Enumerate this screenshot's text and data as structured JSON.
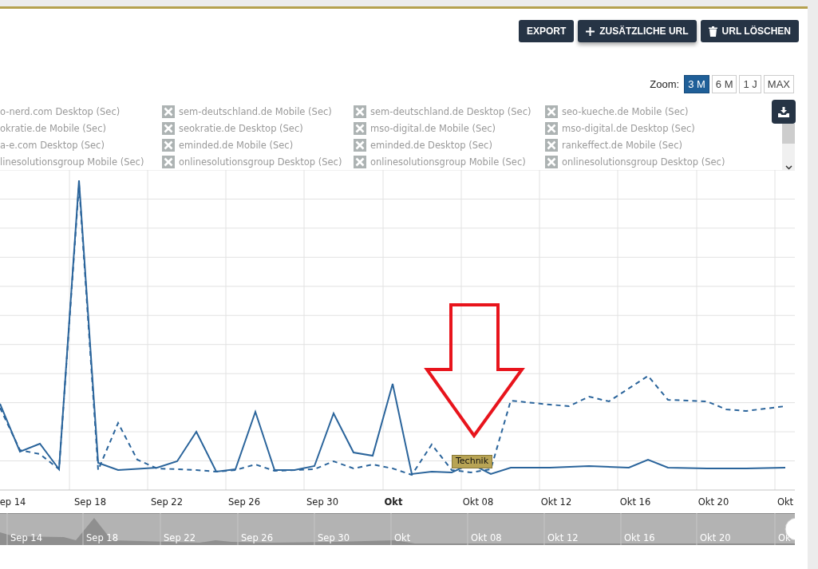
{
  "toolbar": {
    "buttons": [
      {
        "label": "EXPORT",
        "kind": "plain"
      },
      {
        "label": "ZUSÄTZLICHE URL",
        "kind": "add"
      },
      {
        "label": "URL LÖSCHEN",
        "kind": "delete"
      }
    ]
  },
  "zoom": {
    "label": "Zoom:",
    "options": [
      {
        "label": "3 M",
        "selected": true
      },
      {
        "label": "6 M",
        "selected": false
      },
      {
        "label": "1 J",
        "selected": false
      },
      {
        "label": "MAX",
        "selected": false
      }
    ]
  },
  "legend": {
    "items": [
      {
        "label": "o-nerd.com Desktop (Sec)",
        "kind": "partial"
      },
      {
        "label": "sem-deutschland.de Mobile (Sec)",
        "kind": "full"
      },
      {
        "label": "sem-deutschland.de Desktop (Sec)",
        "kind": "full"
      },
      {
        "label": "seo-kueche.de Mobile (Sec)",
        "kind": "full"
      },
      {
        "label": "okratie.de Mobile (Sec)",
        "kind": "partial"
      },
      {
        "label": "seokratie.de Desktop (Sec)",
        "kind": "full"
      },
      {
        "label": "mso-digital.de Mobile (Sec)",
        "kind": "full"
      },
      {
        "label": "mso-digital.de Desktop (Sec)",
        "kind": "full"
      },
      {
        "label": "a-e.com Desktop (Sec)",
        "kind": "partial"
      },
      {
        "label": "eminded.de Mobile (Sec)",
        "kind": "full"
      },
      {
        "label": "eminded.de Desktop (Sec)",
        "kind": "full"
      },
      {
        "label": "rankeffect.de Mobile (Sec)",
        "kind": "full"
      },
      {
        "label": "linesolutionsgroup Mobile (Sec)",
        "kind": "partial"
      },
      {
        "label": "onlinesolutionsgroup Desktop (Sec)",
        "kind": "full"
      },
      {
        "label": "onlinesolutionsgroup Mobile (Sec)",
        "kind": "full"
      },
      {
        "label": "onlinesolutionsgroup Desktop (Sec)",
        "kind": "full"
      }
    ]
  },
  "chart": {
    "x_labels": [
      {
        "label": "ep 14",
        "bold": false
      },
      {
        "label": "Sep 18",
        "bold": false
      },
      {
        "label": "Sep 22",
        "bold": false
      },
      {
        "label": "Sep 26",
        "bold": false
      },
      {
        "label": "Sep 30",
        "bold": false
      },
      {
        "label": "Okt",
        "bold": true
      },
      {
        "label": "Okt 08",
        "bold": false
      },
      {
        "label": "Okt 12",
        "bold": false
      },
      {
        "label": "Okt 16",
        "bold": false
      },
      {
        "label": "Okt 20",
        "bold": false
      },
      {
        "label": "Okt",
        "bold": false
      }
    ],
    "tooltip": "Technik"
  },
  "navigator": {
    "labels": [
      "Sep 14",
      "Sep 18",
      "Sep 22",
      "Sep 26",
      "Sep 30",
      "Okt",
      "Okt 08",
      "Okt 12",
      "Okt 16",
      "Okt 20",
      "Ok"
    ]
  }
}
